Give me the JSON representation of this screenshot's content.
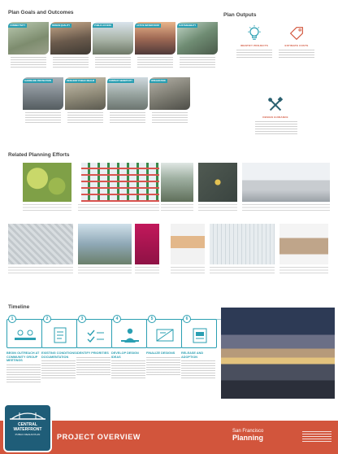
{
  "goals_section": {
    "title": "Plan Goals and Outcomes",
    "goals": [
      {
        "label": "CONNECTIVITY"
      },
      {
        "label": "DESIGN QUALITY"
      },
      {
        "label": "PUBLIC ACCESS"
      },
      {
        "label": "ACTIVE WATERFRONT"
      },
      {
        "label": "SUSTAINABILITY"
      },
      {
        "label": "SHORELINE PROTECTION"
      },
      {
        "label": "RESILIENT PUBLIC REALM"
      },
      {
        "label": "CONTEXT SENSITIVITY"
      },
      {
        "label": "INTEGRATION"
      }
    ]
  },
  "outputs_section": {
    "title": "Plan Outputs",
    "outputs": [
      {
        "label": "IDENTIFY PROJECTS",
        "icon": "lightbulb-icon"
      },
      {
        "label": "ESTIMATE COSTS",
        "icon": "price-tag-icon"
      },
      {
        "label": "DESIGN GUIDANCE",
        "icon": "tools-icon"
      }
    ]
  },
  "related_section": {
    "title": "Related Planning Efforts"
  },
  "timeline_section": {
    "title": "Timeline",
    "steps": [
      {
        "num": "1",
        "date": "",
        "title": "BEGIN OUTREACH AT COMMUNITY GROUP MEETINGS"
      },
      {
        "num": "2",
        "date": "",
        "title": "EXISTING CONDITIONS DOCUMENTATION"
      },
      {
        "num": "3",
        "date": "",
        "title": "IDENTIFY PRIORITIES"
      },
      {
        "num": "4",
        "date": "",
        "title": "DEVELOP DESIGN IDEAS"
      },
      {
        "num": "5",
        "date": "",
        "title": "FINALIZE DESIGNS"
      },
      {
        "num": "6",
        "date": "",
        "title": "RELEASE AND ADOPTION"
      }
    ]
  },
  "footer": {
    "badge_line1": "CENTRAL",
    "badge_line2": "WATERFRONT",
    "badge_line3": "PUBLIC REALM PLAN",
    "title": "PROJECT OVERVIEW",
    "org_line1": "San Francisco",
    "org_line2": "Planning"
  },
  "colors": {
    "accent": "#2a9fb2",
    "footer": "#d2553c"
  }
}
